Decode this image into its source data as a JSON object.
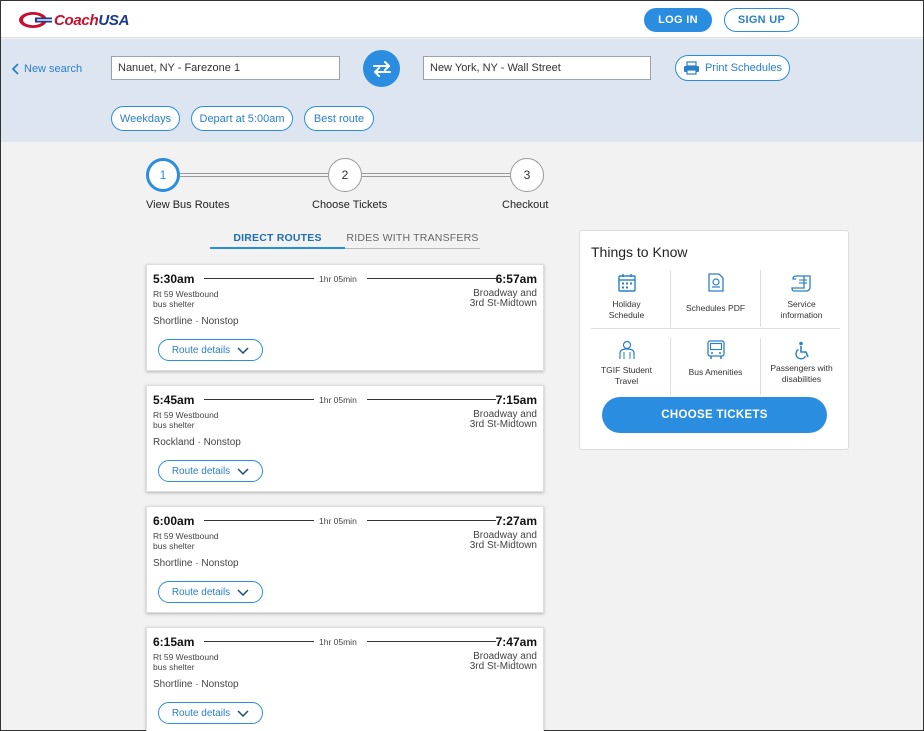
{
  "brand": {
    "name_part1": "Coach",
    "name_part2": "USA",
    "red": "#c8102e",
    "blue": "#1b3a8f"
  },
  "header": {
    "login_label": "LOG IN",
    "signup_label": "SIGN UP"
  },
  "search": {
    "new_search_label": "New search",
    "origin": "Nanuet, NY - Farezone 1",
    "destination": "New York, NY - Wall Street",
    "print_label": "Print Schedules",
    "filters": [
      "Weekdays",
      "Depart at 5:00am",
      "Best route"
    ]
  },
  "steps": [
    {
      "number": "1",
      "label": "View Bus Routes"
    },
    {
      "number": "2",
      "label": "Choose Tickets"
    },
    {
      "number": "3",
      "label": "Checkout"
    }
  ],
  "tabs": {
    "direct": "DIRECT ROUTES",
    "transfers": "RIDES WITH TRANSFERS"
  },
  "routes": [
    {
      "depart": "5:30am",
      "arrive": "6:57am",
      "duration": "1hr 05min",
      "from_line1": "Rt 59 Westbound",
      "from_line2": "bus shelter",
      "to_line1": "Broadway and",
      "to_line2": "3rd St-Midtown",
      "service": "Shortline · Nonstop",
      "details_label": "Route details"
    },
    {
      "depart": "5:45am",
      "arrive": "7:15am",
      "duration": "1hr 05min",
      "from_line1": "Rt 59 Westbound",
      "from_line2": "bus shelter",
      "to_line1": "Broadway and",
      "to_line2": "3rd St-Midtown",
      "service": "Rockland · Nonstop",
      "details_label": "Route details"
    },
    {
      "depart": "6:00am",
      "arrive": "7:27am",
      "duration": "1hr 05min",
      "from_line1": "Rt 59 Westbound",
      "from_line2": "bus shelter",
      "to_line1": "Broadway and",
      "to_line2": "3rd St-Midtown",
      "service": "Shortline · Nonstop",
      "details_label": "Route details"
    },
    {
      "depart": "6:15am",
      "arrive": "7:47am",
      "duration": "1hr 05min",
      "from_line1": "Rt 59 Westbound",
      "from_line2": "bus shelter",
      "to_line1": "Broadway and",
      "to_line2": "3rd St-Midtown",
      "service": "Shortline · Nonstop",
      "details_label": "Route details"
    }
  ],
  "info": {
    "title": "Things to Know",
    "items": [
      {
        "icon": "calendar-icon",
        "label_line1": "Holiday",
        "label_line2": "Schedule"
      },
      {
        "icon": "pdf-document-icon",
        "label_line1": "Schedules PDF",
        "label_line2": ""
      },
      {
        "icon": "scroll-icon",
        "label_line1": "Service",
        "label_line2": "information"
      },
      {
        "icon": "student-icon",
        "label_line1": "TGIF Student",
        "label_line2": "Travel"
      },
      {
        "icon": "bus-icon",
        "label_line1": "Bus Amenities",
        "label_line2": ""
      },
      {
        "icon": "wheelchair-icon",
        "label_line1": "Passengers with",
        "label_line2": "disabilities"
      }
    ],
    "cta_label": "CHOOSE TICKETS"
  },
  "colors": {
    "accent": "#2a8de0",
    "link": "#2a7fc9",
    "search_bg": "#dde6f0",
    "page_bg": "#f2f2f2"
  }
}
